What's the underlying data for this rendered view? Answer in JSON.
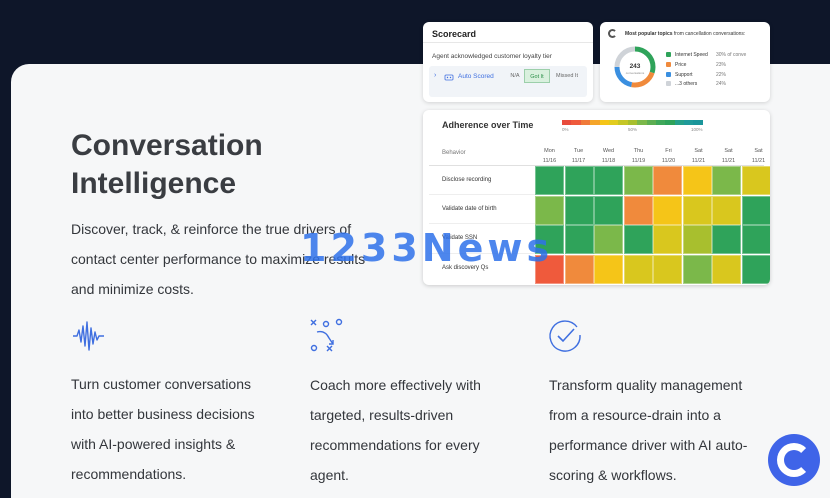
{
  "hero": {
    "title_line1": "Conversation",
    "title_line2": "Intelligence",
    "desc_line1": "Discover, track, & reinforce the true drivers of",
    "desc_line2": "contact center performance to maximize results",
    "desc_line3": "and minimize costs."
  },
  "features": [
    {
      "icon": "soundwave-icon",
      "lines": [
        "Turn customer conversations",
        "into better business decisions",
        "with AI-powered insights &",
        "recommendations."
      ]
    },
    {
      "icon": "strategy-play-icon",
      "lines": [
        "Coach more effectively with",
        "targeted, results-driven",
        "recommendations for every",
        "agent."
      ]
    },
    {
      "icon": "check-circle-icon",
      "lines": [
        "Transform quality management",
        "from a resource-drain into a",
        "performance driver with AI auto-",
        "scoring & workflows."
      ]
    }
  ],
  "scorecard": {
    "title": "Scorecard",
    "question": "Agent acknowledged customer loyalty tier",
    "auto_label": "Auto Scored",
    "option_na": "N/A",
    "option_got": "Got It",
    "option_missed": "Missed It"
  },
  "topics": {
    "header_bold": "Most popular topics",
    "header_rest": " from cancellation conversations:",
    "center_value": "243",
    "center_label": "conversations",
    "items": [
      {
        "label": "Internet Speed",
        "pct": "30% of conve",
        "color": "#2fa35a"
      },
      {
        "label": "Price",
        "pct": "23%",
        "color": "#f08a3c"
      },
      {
        "label": "Support",
        "pct": "22%",
        "color": "#3a8fe0"
      },
      {
        "label": "...3 others",
        "pct": "24%",
        "color": "#cfd3d8"
      }
    ]
  },
  "adherence": {
    "title": "Adherence over Time",
    "scale_left": "0%",
    "scale_mid": "50%",
    "scale_right": "100%",
    "behavior_header": "Behavior",
    "days": [
      {
        "dow": "Mon",
        "date": "11/16"
      },
      {
        "dow": "Tue",
        "date": "11/17"
      },
      {
        "dow": "Wed",
        "date": "11/18"
      },
      {
        "dow": "Thu",
        "date": "11/19"
      },
      {
        "dow": "Fri",
        "date": "11/20"
      },
      {
        "dow": "Sat",
        "date": "11/21"
      },
      {
        "dow": "Sat",
        "date": "11/21"
      },
      {
        "dow": "Sat",
        "date": "11/21"
      }
    ],
    "behaviors": [
      "Disclose recording",
      "Validate date of birth",
      "Validate SSN",
      "Ask discovery Qs"
    ],
    "grid": [
      [
        "#2fa35a",
        "#2fa35a",
        "#2fa35a",
        "#7bb84a",
        "#f08a3c",
        "#f5c518",
        "#7bb84a",
        "#d9c71e"
      ],
      [
        "#7bb84a",
        "#2fa35a",
        "#2fa35a",
        "#f08a3c",
        "#f5c518",
        "#d9c71e",
        "#d9c71e",
        "#2fa35a"
      ],
      [
        "#2fa35a",
        "#2fa35a",
        "#7bb84a",
        "#2fa35a",
        "#d9c71e",
        "#a8bf2e",
        "#2fa35a",
        "#2fa35a"
      ],
      [
        "#ef5a3c",
        "#f08a3c",
        "#f5c518",
        "#d9c71e",
        "#d9c71e",
        "#7bb84a",
        "#d9c71e",
        "#2fa35a"
      ]
    ],
    "scale_colors": [
      "#e84b3c",
      "#ef5a3c",
      "#f07a3a",
      "#f5a52a",
      "#f5c518",
      "#e2cc1e",
      "#c5c626",
      "#a8bf2e",
      "#7bb84a",
      "#5cae52",
      "#3fa85a",
      "#2fa35a",
      "#25a08a",
      "#1f9a9a",
      "#1a959a"
    ]
  },
  "watermark": "1233News"
}
